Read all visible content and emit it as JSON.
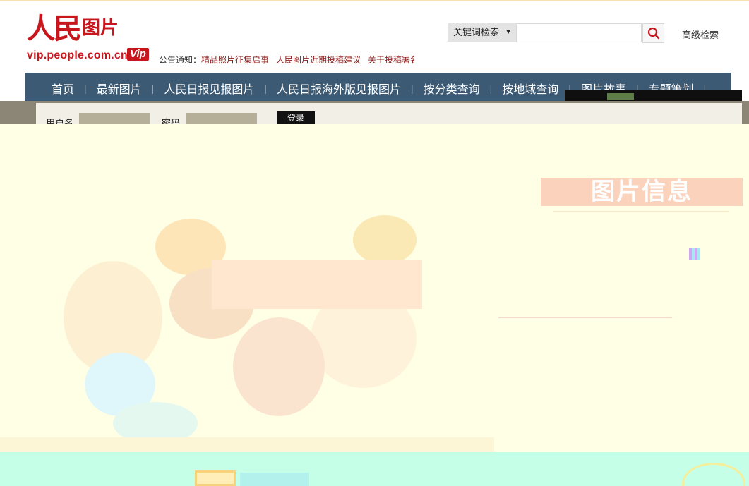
{
  "header": {
    "logo_cn": "人民",
    "logo_cn_small": "图片",
    "logo_url": "vip.people.com.cn",
    "logo_vip": "Vip",
    "notice_label": "公告通知：",
    "notice_items": [
      "精品照片征集启事",
      "人民图片近期投稿建议",
      "关于投稿署名"
    ]
  },
  "search": {
    "type_label": "关键词检索",
    "placeholder": "",
    "advanced_label": "高级检索"
  },
  "nav": {
    "items": [
      "首页",
      "最新图片",
      "人民日报见报图片",
      "人民日报海外版见报图片",
      "按分类查询",
      "按地域查询",
      "图片故事",
      "专题策划"
    ]
  },
  "login": {
    "username_label": "用户名",
    "password_label": "密码",
    "button_label": "登录"
  },
  "main": {
    "info_heading": "图片信息"
  },
  "colors": {
    "brand_red": "#c8161d",
    "nav_bg": "#3d5a74"
  }
}
